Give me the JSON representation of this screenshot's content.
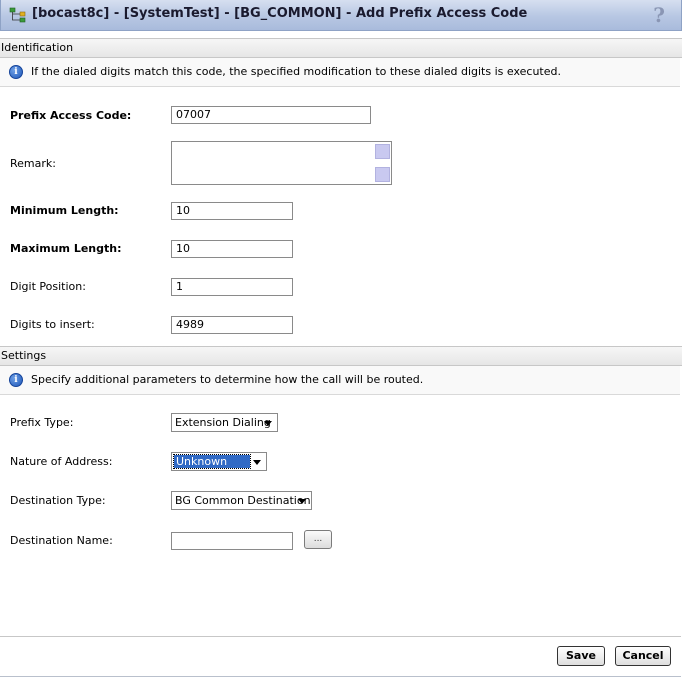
{
  "window": {
    "title": "[bocast8c] - [SystemTest] - [BG_COMMON] - Add Prefix Access Code",
    "help_glyph": "?"
  },
  "identification": {
    "header": "Identification",
    "info": "If the dialed digits match this code, the specified modification to these dialed digits is executed.",
    "fields": {
      "prefix_access_code": {
        "label": "Prefix Access Code:",
        "value": "07007"
      },
      "remark": {
        "label": "Remark:",
        "value": ""
      },
      "minimum_length": {
        "label": "Minimum Length:",
        "value": "10"
      },
      "maximum_length": {
        "label": "Maximum Length:",
        "value": "10"
      },
      "digit_position": {
        "label": "Digit Position:",
        "value": "1"
      },
      "digits_to_insert": {
        "label": "Digits to insert:",
        "value": "4989"
      }
    }
  },
  "settings": {
    "header": "Settings",
    "info": "Specify additional parameters to determine how the call will be routed.",
    "fields": {
      "prefix_type": {
        "label": "Prefix Type:",
        "value": "Extension Dialing"
      },
      "nature_of_address": {
        "label": "Nature of Address:",
        "value": "Unknown"
      },
      "destination_type": {
        "label": "Destination Type:",
        "value": "BG Common Destination"
      },
      "destination_name": {
        "label": "Destination Name:",
        "value": "",
        "browse_label": "..."
      }
    }
  },
  "actions": {
    "save": "Save",
    "cancel": "Cancel"
  },
  "icons": {
    "title": "network-tree-icon",
    "help": "help-icon",
    "info": "info-icon"
  }
}
